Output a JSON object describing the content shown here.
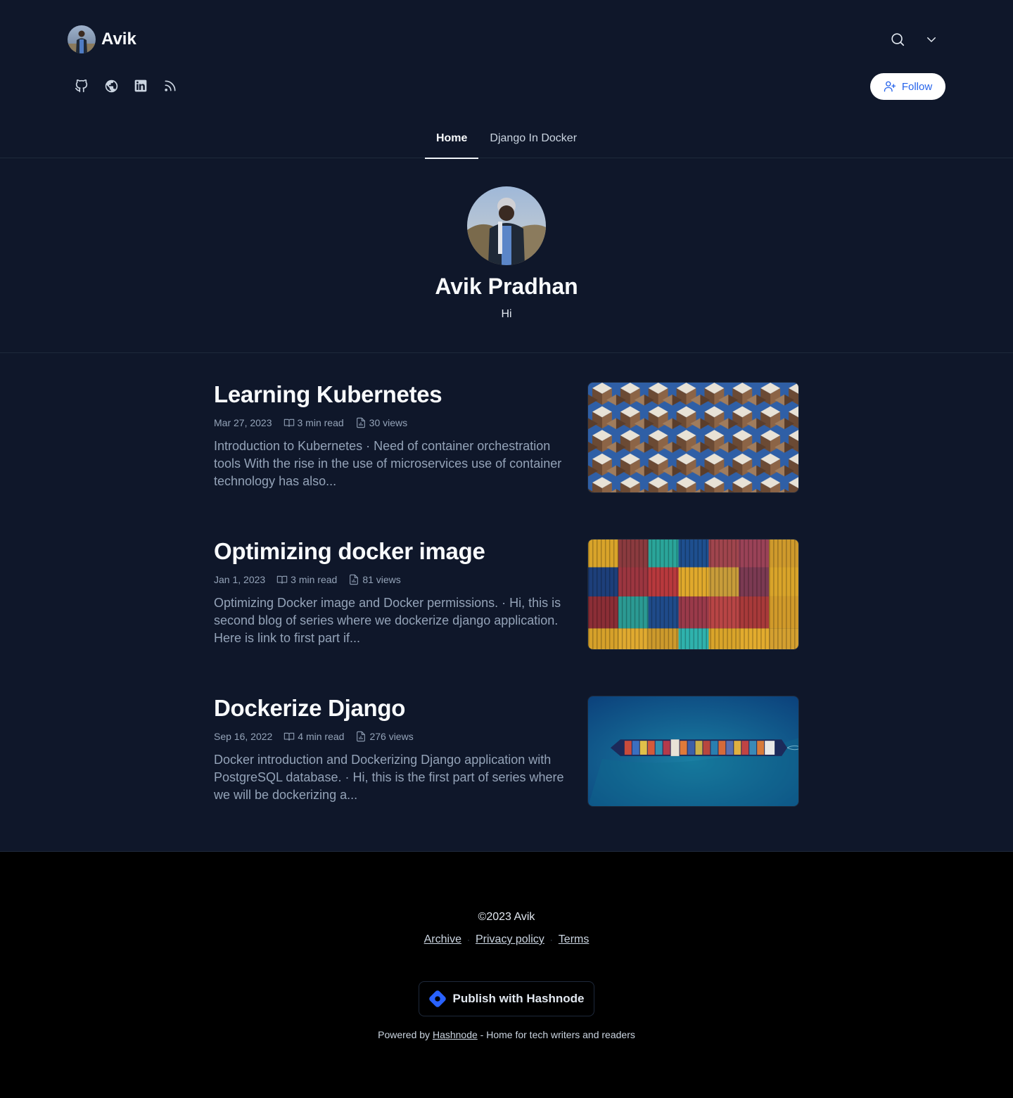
{
  "header": {
    "brand_name": "Avik",
    "follow_label": "Follow",
    "icons": [
      "search-icon",
      "chevron-down-icon"
    ],
    "socials": [
      "github-icon",
      "globe-icon",
      "linkedin-icon",
      "rss-icon"
    ]
  },
  "nav": {
    "tabs": [
      {
        "label": "Home",
        "active": true
      },
      {
        "label": "Django In Docker",
        "active": false
      }
    ]
  },
  "profile": {
    "name": "Avik Pradhan",
    "bio": "Hi"
  },
  "posts": [
    {
      "title": "Learning Kubernetes",
      "date": "Mar 27, 2023",
      "read_time": "3 min read",
      "views": "30 views",
      "excerpt": "Introduction to Kubernetes · Need of container orchestration tools With the rise in the use of microservices use of container technology has also..."
    },
    {
      "title": "Optimizing docker image",
      "date": "Jan 1, 2023",
      "read_time": "3 min read",
      "views": "81 views",
      "excerpt": "Optimizing Docker image and Docker permissions. · Hi, this is second blog of series where we dockerize django application. Here is link to first part if..."
    },
    {
      "title": "Dockerize Django",
      "date": "Sep 16, 2022",
      "read_time": "4 min read",
      "views": "276 views",
      "excerpt": "Docker introduction and Dockerizing Django application with PostgreSQL database. · Hi, this is the first part of series where we will be dockerizing a..."
    }
  ],
  "footer": {
    "copyright": "©2023 Avik",
    "links": [
      "Archive",
      "Privacy policy",
      "Terms"
    ],
    "publish_label": "Publish with Hashnode",
    "powered_prefix": "Powered by",
    "powered_link": "Hashnode",
    "powered_suffix": "- Home for tech writers and readers"
  },
  "colors": {
    "background": "#0f172a",
    "footer_bg": "#000000",
    "accent": "#2563eb",
    "muted_text": "#94a3b8"
  }
}
